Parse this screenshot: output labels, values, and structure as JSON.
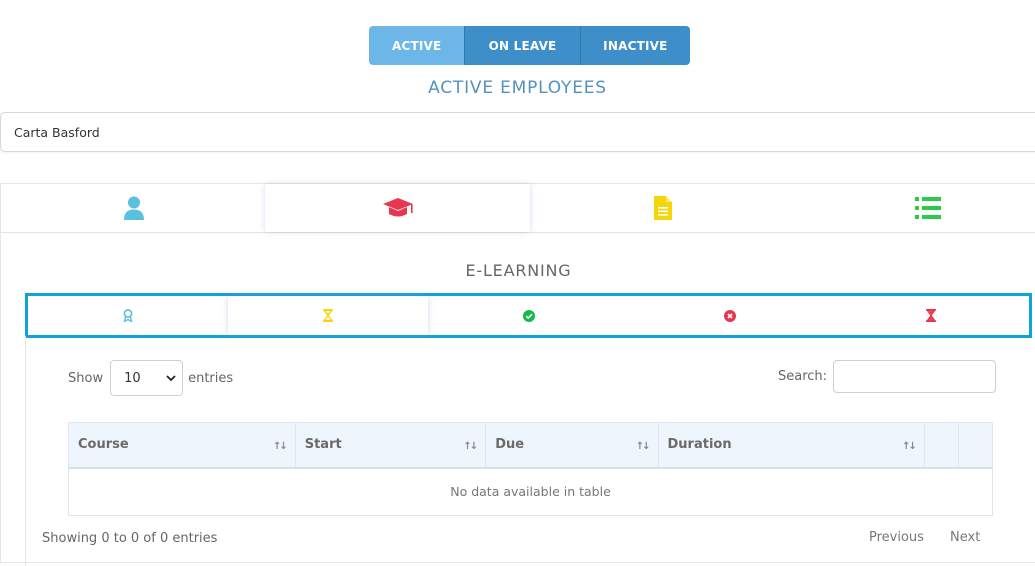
{
  "status_tabs": [
    "ACTIVE",
    "ON LEAVE",
    "INACTIVE"
  ],
  "page_title": "ACTIVE EMPLOYEES",
  "employee": "Carta Basford",
  "main_tabs": [
    {
      "icon": "user-icon",
      "color": "#5bc0de"
    },
    {
      "icon": "graduation-cap-icon",
      "color": "#e8364e"
    },
    {
      "icon": "document-icon",
      "color": "#f5d60a"
    },
    {
      "icon": "list-icon",
      "color": "#2bcc45"
    }
  ],
  "section_title": "E-LEARNING",
  "sub_tabs": [
    {
      "icon": "award-icon",
      "color": "#5bc0de"
    },
    {
      "icon": "hourglass-icon",
      "color": "#f5d60a"
    },
    {
      "icon": "check-circle-icon",
      "color": "#17b84a"
    },
    {
      "icon": "times-circle-icon",
      "color": "#e8364e"
    },
    {
      "icon": "hourglass-end-icon",
      "color": "#e8364e"
    }
  ],
  "table": {
    "show_label": "Show",
    "length_value": "10",
    "entries_label": "entries",
    "search_label": "Search:",
    "columns": [
      "Course",
      "Start",
      "Due",
      "Duration",
      "",
      ""
    ],
    "empty_message": "No data available in table",
    "info": "Showing 0 to 0 of 0 entries",
    "previous": "Previous",
    "next": "Next"
  }
}
